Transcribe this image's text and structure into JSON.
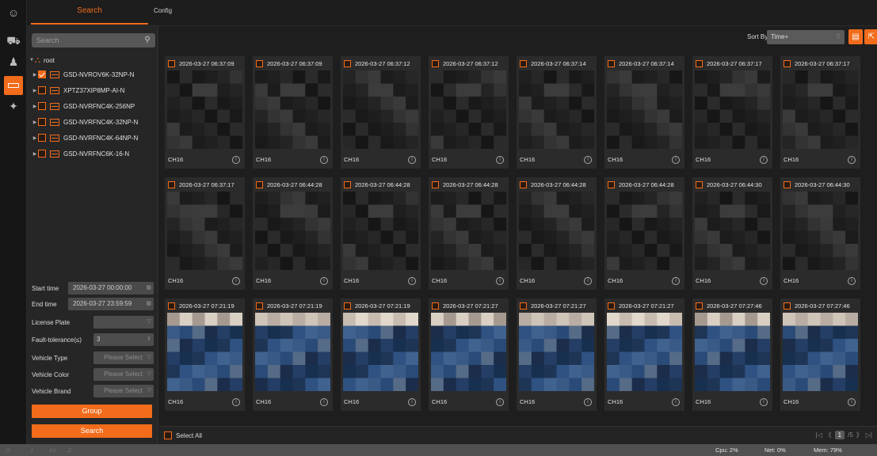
{
  "tabs": {
    "search": "Search",
    "config": "Config"
  },
  "search": {
    "placeholder": "Search"
  },
  "tree": {
    "root": "root",
    "devices": [
      {
        "name": "GSD-NVROV6K-32NP-N",
        "checked": true
      },
      {
        "name": "XPTZ37XIP8MP-AI-N",
        "checked": false
      },
      {
        "name": "GSD-NVRFNC4K-256NP",
        "checked": false
      },
      {
        "name": "GSD-NVRFNC4K-32NP-N",
        "checked": false
      },
      {
        "name": "GSD-NVRFNC4K-64NP-N",
        "checked": false
      },
      {
        "name": "GSD-NVRFNC6K-16-N",
        "checked": false
      }
    ]
  },
  "filters": {
    "start_label": "Start time",
    "start_value": "2026-03-27 00:00:00",
    "end_label": "End time",
    "end_value": "2026-03-27 23:59:59",
    "plate_label": "License Plate",
    "plate_value": "",
    "fault_label": "Fault-tolerance(≤)",
    "fault_value": "3",
    "type_label": "Vehicle Type",
    "type_placeholder": "Please Select",
    "color_label": "Vehicle Color",
    "color_placeholder": "Please Select",
    "brand_label": "Vehicle Brand",
    "brand_placeholder": "Please Select",
    "group_button": "Group",
    "search_button": "Search"
  },
  "toolbar": {
    "sort_label": "Sort By",
    "sort_value": "Time+"
  },
  "results": [
    {
      "time": "2026-03-27 06:37:09",
      "channel": "CH16",
      "scene": "dark"
    },
    {
      "time": "2026-03-27 06:37:09",
      "channel": "CH16",
      "scene": "dark"
    },
    {
      "time": "2026-03-27 06:37:12",
      "channel": "CH16",
      "scene": "dark"
    },
    {
      "time": "2026-03-27 06:37:12",
      "channel": "CH16",
      "scene": "dark"
    },
    {
      "time": "2026-03-27 06:37:14",
      "channel": "CH16",
      "scene": "dark"
    },
    {
      "time": "2026-03-27 06:37:14",
      "channel": "CH16",
      "scene": "dark"
    },
    {
      "time": "2026-03-27 06:37:17",
      "channel": "CH16",
      "scene": "dark"
    },
    {
      "time": "2026-03-27 06:37:17",
      "channel": "CH16",
      "scene": "dark"
    },
    {
      "time": "2026-03-27 06:37:17",
      "channel": "CH16",
      "scene": "dark"
    },
    {
      "time": "2026-03-27 06:44:28",
      "channel": "CH16",
      "scene": "dark"
    },
    {
      "time": "2026-03-27 06:44:28",
      "channel": "CH16",
      "scene": "dark"
    },
    {
      "time": "2026-03-27 06:44:28",
      "channel": "CH16",
      "scene": "dark"
    },
    {
      "time": "2026-03-27 06:44:28",
      "channel": "CH16",
      "scene": "dark"
    },
    {
      "time": "2026-03-27 06:44:28",
      "channel": "CH16",
      "scene": "dark"
    },
    {
      "time": "2026-03-27 06:44:30",
      "channel": "CH16",
      "scene": "dark"
    },
    {
      "time": "2026-03-27 06:44:30",
      "channel": "CH16",
      "scene": "dark"
    },
    {
      "time": "2026-03-27 07:21:19",
      "channel": "CH16",
      "scene": "day"
    },
    {
      "time": "2026-03-27 07:21:19",
      "channel": "CH16",
      "scene": "day"
    },
    {
      "time": "2026-03-27 07:21:19",
      "channel": "CH16",
      "scene": "day"
    },
    {
      "time": "2026-03-27 07:21:27",
      "channel": "CH16",
      "scene": "day"
    },
    {
      "time": "2026-03-27 07:21:27",
      "channel": "CH16",
      "scene": "day"
    },
    {
      "time": "2026-03-27 07:21:27",
      "channel": "CH16",
      "scene": "day"
    },
    {
      "time": "2026-03-27 07:27:46",
      "channel": "CH16",
      "scene": "day"
    },
    {
      "time": "2026-03-27 07:27:46",
      "channel": "CH16",
      "scene": "day"
    }
  ],
  "footer": {
    "select_all": "Select All",
    "page_current": "1",
    "page_total": "/5"
  },
  "status": {
    "cpu": "Cpu: 2%",
    "net": "Net: 0%",
    "mem": "Mem: 79%"
  },
  "colors": {
    "accent": "#f26c1b",
    "panel": "#262626",
    "background": "#1b1b1b"
  }
}
